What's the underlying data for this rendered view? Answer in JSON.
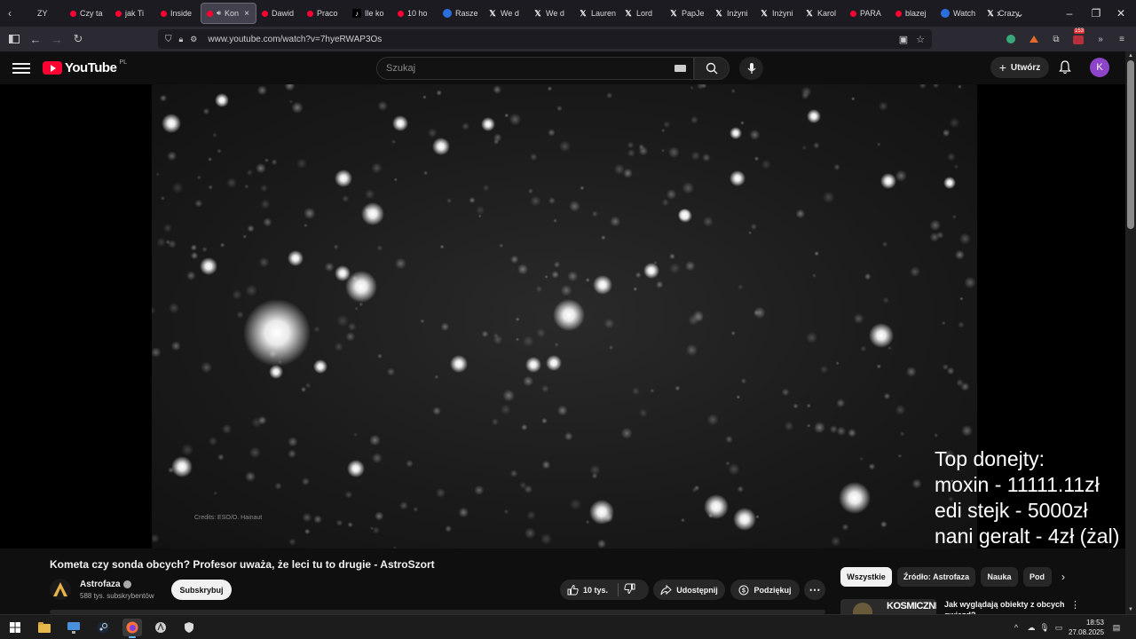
{
  "browser": {
    "tabs": [
      {
        "label": "ZY",
        "icon": "tab-favicon",
        "active": false
      },
      {
        "label": "Czy ta",
        "icon": "youtube-icon",
        "active": false
      },
      {
        "label": "jak Ti",
        "icon": "youtube-icon",
        "active": false
      },
      {
        "label": "Inside",
        "icon": "youtube-icon",
        "active": false
      },
      {
        "label": "Kon",
        "icon": "youtube-icon",
        "active": true
      },
      {
        "label": "Dawid",
        "icon": "youtube-icon",
        "active": false
      },
      {
        "label": "Praco",
        "icon": "youtube-icon",
        "active": false
      },
      {
        "label": "Ile ko",
        "icon": "tiktok-icon",
        "active": false
      },
      {
        "label": "10 ho",
        "icon": "youtube-icon",
        "active": false
      },
      {
        "label": "Rasze",
        "icon": "globe-icon",
        "active": false
      },
      {
        "label": "We d",
        "icon": "x-icon",
        "active": false
      },
      {
        "label": "We d",
        "icon": "x-icon",
        "active": false
      },
      {
        "label": "Lauren",
        "icon": "x-icon",
        "active": false
      },
      {
        "label": "Lord",
        "icon": "x-icon",
        "active": false
      },
      {
        "label": "PapJe",
        "icon": "x-icon",
        "active": false
      },
      {
        "label": "Inżyni",
        "icon": "x-icon",
        "active": false
      },
      {
        "label": "Inżyni",
        "icon": "x-icon",
        "active": false
      },
      {
        "label": "Karol",
        "icon": "x-icon",
        "active": false
      },
      {
        "label": "PARA",
        "icon": "youtube-icon",
        "active": false
      },
      {
        "label": "blazej",
        "icon": "youtube-icon",
        "active": false
      },
      {
        "label": "Watch",
        "icon": "globe-icon",
        "active": false
      },
      {
        "label": "Crazy",
        "icon": "x-icon",
        "active": false
      }
    ],
    "url": "www.youtube.com/watch?v=7hyeRWAP3Os",
    "notification_badge": "153"
  },
  "youtube": {
    "logo_text": "YouTube",
    "region": "PL",
    "search_placeholder": "Szukaj",
    "create_label": "Utwórz",
    "avatar_letter": "K"
  },
  "video": {
    "credits": "Credits: ESO/O. Hainaut",
    "donation_lines": [
      "Top donejty:",
      "moxin - 11111.11zł",
      "edi stejk - 5000zł",
      "nani geralt - 4zł (żal)"
    ],
    "title": "Kometa czy sonda obcych? Profesor uważa, że leci tu to drugie - AstroSzort"
  },
  "channel": {
    "name": "Astrofaza",
    "subscribers": "588 tys. subskrybentów",
    "subscribe_label": "Subskrybuj"
  },
  "actions": {
    "likes": "10 tys.",
    "share": "Udostępnij",
    "thanks": "Podziękuj"
  },
  "chips": [
    {
      "label": "Wszystkie",
      "selected": true
    },
    {
      "label": "Źródło: Astrofaza",
      "selected": false
    },
    {
      "label": "Nauka",
      "selected": false
    },
    {
      "label": "Pod",
      "selected": false
    }
  ],
  "recommendation": {
    "thumb_text": "KOSMICZNI",
    "title": "Jak wyglądają obiekty z obcych gwiazd?"
  },
  "taskbar": {
    "time": "18:53",
    "date": "27.08.2025"
  },
  "colors": {
    "youtube_red": "#ff0033",
    "background": "#0f0f0f",
    "avatar": "#8e44c9"
  }
}
